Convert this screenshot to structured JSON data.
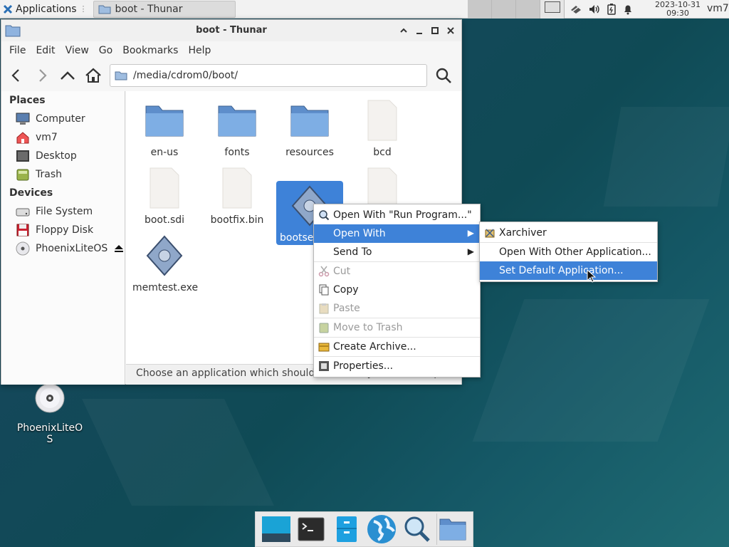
{
  "panel": {
    "applications_label": "Applications",
    "task_label": "boot - Thunar",
    "clock_date": "2023-10-31",
    "clock_time": "09:30",
    "user": "vm7"
  },
  "window": {
    "title": "boot - Thunar",
    "menu": [
      "File",
      "Edit",
      "View",
      "Go",
      "Bookmarks",
      "Help"
    ],
    "path": "/media/cdrom0/boot/"
  },
  "sidebar": {
    "places_header": "Places",
    "places": [
      "Computer",
      "vm7",
      "Desktop",
      "Trash"
    ],
    "devices_header": "Devices",
    "devices": [
      "File System",
      "Floppy Disk",
      "PhoenixLiteOS"
    ]
  },
  "files": [
    {
      "name": "en-us",
      "kind": "folder"
    },
    {
      "name": "fonts",
      "kind": "folder"
    },
    {
      "name": "resources",
      "kind": "folder"
    },
    {
      "name": "bcd",
      "kind": "file"
    },
    {
      "name": "boot.sdi",
      "kind": "file"
    },
    {
      "name": "bootfix.bin",
      "kind": "file"
    },
    {
      "name": "bootsec",
      "kind": "exe",
      "selected": true
    },
    {
      "name": "",
      "kind": "file"
    },
    {
      "name": "memtest.exe",
      "kind": "exe"
    }
  ],
  "status_text": "Choose an application which should be used by default to open th...",
  "context_menu": {
    "items": [
      {
        "label": "Open With \"Run Program...\"",
        "icon": "run-icon"
      },
      {
        "label": "Open With",
        "submenu": true,
        "highlighted": true
      },
      {
        "label": "Send To",
        "submenu": true
      },
      {
        "label": "Cut",
        "icon": "cut-icon",
        "disabled": true
      },
      {
        "label": "Copy",
        "icon": "copy-icon"
      },
      {
        "label": "Paste",
        "icon": "paste-icon",
        "disabled": true
      },
      {
        "label": "Move to Trash",
        "icon": "trash-icon",
        "disabled": true
      },
      {
        "label": "Create Archive...",
        "icon": "archive-icon"
      },
      {
        "label": "Properties...",
        "icon": "properties-icon"
      }
    ]
  },
  "submenu": {
    "items": [
      {
        "label": "Xarchiver",
        "icon": "xarchiver-icon"
      },
      {
        "label": "Open With Other Application..."
      },
      {
        "label": "Set Default Application...",
        "highlighted": true
      }
    ]
  },
  "desktop": {
    "icon_label_line1": "PhoenixLiteO",
    "icon_label_line2": "S"
  },
  "colors": {
    "accent": "#3e82d8",
    "folder": "#6a9fd8"
  }
}
